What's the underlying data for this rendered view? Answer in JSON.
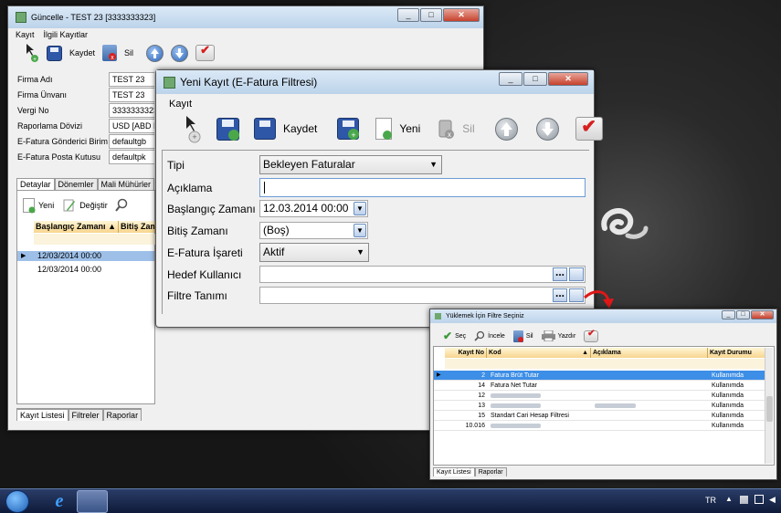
{
  "back_window": {
    "title": "Güncelle - TEST 23 [3333333323]",
    "menu": [
      "Kayıt",
      "İlgili Kayıtlar"
    ],
    "toolbar": {
      "save": "Kaydet",
      "delete": "Sil"
    },
    "fields": [
      {
        "label": "Firma Adı",
        "value": "TEST 23"
      },
      {
        "label": "Firma Ünvanı",
        "value": "TEST 23"
      },
      {
        "label": "Vergi No",
        "value": "3333333323"
      },
      {
        "label": "Raporlama Dövizi",
        "value": "USD [ABD Do"
      },
      {
        "label": "E-Fatura Gönderici Birim",
        "value": "defaultgb"
      },
      {
        "label": "E-Fatura Posta Kutusu",
        "value": "defaultpk"
      }
    ],
    "tabs": [
      "Detaylar",
      "Dönemler",
      "Mali Mühürler"
    ],
    "subtoolbar": {
      "new": "Yeni",
      "edit": "Değiştir"
    },
    "grid": {
      "headers": [
        "Başlangıç Zamanı",
        "Bitiş Zama"
      ],
      "rows": [
        "12/03/2014 00:00",
        "12/03/2014 00:00"
      ]
    },
    "bottom_tabs": [
      "Kayıt Listesi",
      "Filtreler",
      "Raporlar"
    ]
  },
  "dialog": {
    "title": "Yeni Kayıt (E-Fatura Filtresi)",
    "menu": [
      "Kayıt"
    ],
    "toolbar": {
      "save": "Kaydet",
      "new": "Yeni",
      "delete": "Sil"
    },
    "fields": {
      "tipi": {
        "label": "Tipi",
        "value": "Bekleyen Faturalar"
      },
      "aciklama": {
        "label": "Açıklama",
        "value": ""
      },
      "baslangic": {
        "label": "Başlangıç Zamanı",
        "value": "12.03.2014 00:00"
      },
      "bitis": {
        "label": "Bitiş Zamanı",
        "value": "(Boş)"
      },
      "isaret": {
        "label": "E-Fatura İşareti",
        "value": "Aktif"
      },
      "hedef": {
        "label": "Hedef Kullanıcı",
        "value": ""
      },
      "filtre": {
        "label": "Filtre Tanımı",
        "value": ""
      }
    }
  },
  "filter_window": {
    "title": "Yüklemek İçin Filtre Seçiniz",
    "toolbar": {
      "select": "Seç",
      "view": "İncele",
      "delete": "Sil",
      "print": "Yazdır"
    },
    "headers": {
      "no": "Kayıt No",
      "code": "Kod",
      "desc": "Açıklama",
      "status": "Kayıt Durumu"
    },
    "rows": [
      {
        "no": "2",
        "code": "Fatura Brüt Tutar",
        "desc": "",
        "status": "Kullanımda",
        "blur_code": false,
        "blur_desc": false
      },
      {
        "no": "14",
        "code": "Fatura Net Tutar",
        "desc": "",
        "status": "Kullanımda",
        "blur_code": false,
        "blur_desc": false
      },
      {
        "no": "12",
        "code": "",
        "desc": "",
        "status": "Kullanımda",
        "blur_code": true,
        "blur_desc": false
      },
      {
        "no": "13",
        "code": "",
        "desc": "",
        "status": "Kullanımda",
        "blur_code": true,
        "blur_desc": true
      },
      {
        "no": "15",
        "code": "Standart Cari Hesap Filtresi",
        "desc": "",
        "status": "Kullanımda",
        "blur_code": false,
        "blur_desc": false
      },
      {
        "no": "10.016",
        "code": "",
        "desc": "",
        "status": "Kullanımda",
        "blur_code": true,
        "blur_desc": false
      }
    ],
    "selected_row": 0,
    "bottom_tabs": [
      "Kayıt Listesi",
      "Raporlar"
    ]
  },
  "taskbar": {
    "lang": "TR"
  },
  "colors": {
    "selection": "#3d8ee6",
    "header": "#f7d58e",
    "accent_red": "#d62020"
  }
}
